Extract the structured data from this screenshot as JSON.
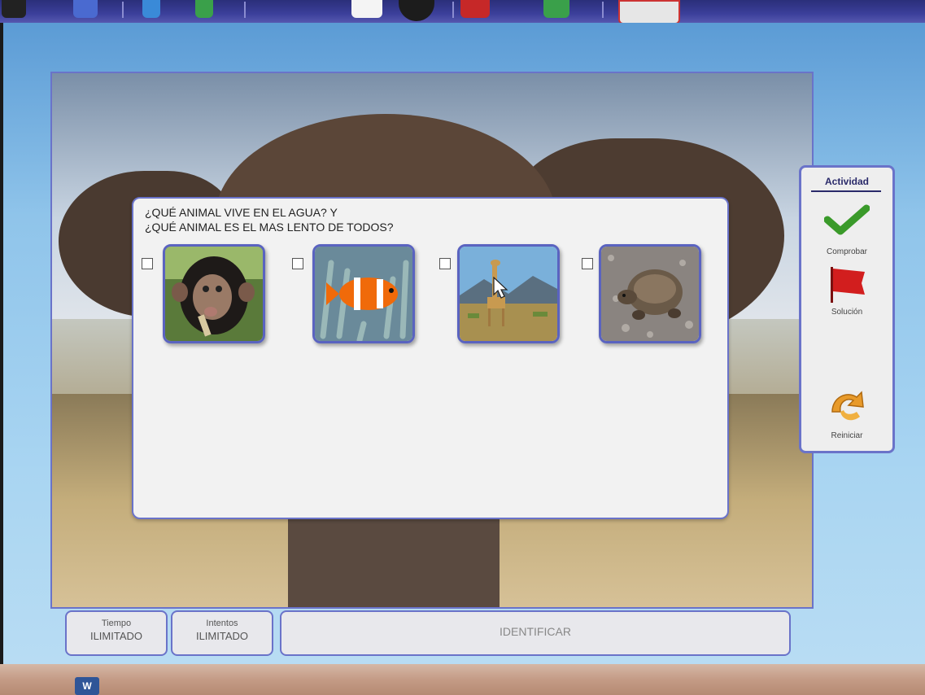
{
  "toolbar": {
    "icons": [
      "app-icon",
      "back-icon",
      "globe-icon",
      "refresh-icon",
      "blank-page-icon",
      "settings-icon",
      "mail-icon",
      "add-icon",
      "card-icon"
    ]
  },
  "activity": {
    "question_line1": "¿QUÉ ANIMAL VIVE EN EL AGUA? Y",
    "question_line2": "¿QUÉ ANIMAL ES EL MAS LENTO DE TODOS?",
    "options": [
      {
        "icon": "chimpanzee-image",
        "checked": false
      },
      {
        "icon": "clownfish-image",
        "checked": false
      },
      {
        "icon": "giraffe-image",
        "checked": false
      },
      {
        "icon": "tortoise-image",
        "checked": false
      }
    ]
  },
  "side_panel": {
    "title": "Actividad",
    "check_label": "Comprobar",
    "solution_label": "Solución",
    "reset_label": "Reiniciar"
  },
  "status": {
    "time_title": "Tiempo",
    "time_value": "ILIMITADO",
    "attempts_title": "Intentos",
    "attempts_value": "ILIMITADO",
    "mode_label": "IDENTIFICAR"
  },
  "taskbar": {
    "word_label": "W"
  },
  "colors": {
    "accent_border": "#6a73c9",
    "check_green": "#3a9a2a",
    "flag_red": "#d21e1e",
    "reset_orange": "#e89a2a"
  }
}
